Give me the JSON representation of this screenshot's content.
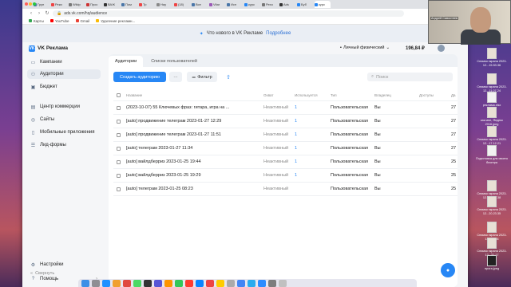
{
  "browser": {
    "tabs": [
      "Груп",
      "Реки",
      "Wikip",
      "Прос",
      "ВАЖ",
      "Пом",
      "Тр",
      "Нау",
      "(18)",
      "Все",
      "Vitar",
      "Исп",
      "курс",
      "Рехо",
      "Ads",
      "Буб",
      "курс"
    ],
    "url": "ads.vk.com/hq/audience",
    "bookmarks": [
      "Карты",
      "YouTube",
      "Gmail",
      "Удаление рекламн..."
    ]
  },
  "announce": {
    "text": "Что нового в VK Рекламе",
    "link": "Подробнее"
  },
  "header": {
    "logo": "VK Реклама",
    "account": "Личный физический",
    "balance": "196,84 ₽"
  },
  "sidebar": {
    "items": [
      {
        "label": "Кампании",
        "icon": "campaigns-icon",
        "glyph": "▭"
      },
      {
        "label": "Аудитории",
        "icon": "audiences-icon",
        "glyph": "👥"
      },
      {
        "label": "Бюджет",
        "icon": "budget-icon",
        "glyph": "▣"
      },
      {
        "label": "Центр коммерции",
        "icon": "commerce-icon",
        "glyph": "▤"
      },
      {
        "label": "Сайты",
        "icon": "sites-icon",
        "glyph": "◎"
      },
      {
        "label": "Мобильные приложения",
        "icon": "mobile-icon",
        "glyph": "▯"
      },
      {
        "label": "Лид-формы",
        "icon": "leadforms-icon",
        "glyph": "☰"
      }
    ],
    "bottom": [
      {
        "label": "Настройки",
        "icon": "settings-icon",
        "glyph": "⚙"
      },
      {
        "label": "Помощь",
        "icon": "help-icon",
        "glyph": "?"
      }
    ],
    "collapse": "Свернуть"
  },
  "panel": {
    "tabs": [
      "Аудитории",
      "Списки пользователей"
    ],
    "create": "Создать аудиторию",
    "filter": "Фильтр",
    "search_placeholder": "Поиск"
  },
  "table": {
    "headers": {
      "name": "Название",
      "coverage": "Охват",
      "used": "Используется",
      "type": "Тип",
      "owner": "Владелец",
      "access": "Доступы",
      "date": "Да"
    },
    "rows": [
      {
        "name": "(2023-10-07) 55 Ключевых фраз: гитара, игра на ...",
        "coverage": "Неактивный",
        "used": "1",
        "type": "Пользовательская",
        "owner": "Вы",
        "date": "27"
      },
      {
        "name": "[auto] продвижение телеграм 2023-01-27 12:29",
        "coverage": "Неактивный",
        "used": "1",
        "type": "Пользовательская",
        "owner": "Вы",
        "date": "27"
      },
      {
        "name": "[auto] продвижение телеграм 2023-01-27 11:51",
        "coverage": "Неактивный",
        "used": "1",
        "type": "Пользовательская",
        "owner": "Вы",
        "date": "27"
      },
      {
        "name": "[auto] телеграм 2023-01-27 11:34",
        "coverage": "Неактивный",
        "used": "1",
        "type": "Пользовательская",
        "owner": "Вы",
        "date": "27"
      },
      {
        "name": "[auto] вайлдберриз 2023-01-25 19:44",
        "coverage": "Неактивный",
        "used": "1",
        "type": "Пользовательская",
        "owner": "Вы",
        "date": "25"
      },
      {
        "name": "[auto] вайлдберриз 2023-01-25 19:29",
        "coverage": "Неактивный",
        "used": "1",
        "type": "Пользовательская",
        "owner": "Вы",
        "date": "25"
      },
      {
        "name": "[auto] телеграм 2023-01-25 08:23",
        "coverage": "Неактивный",
        "used": "",
        "type": "Пользовательская",
        "owner": "Вы",
        "date": "25"
      }
    ]
  },
  "video": {
    "name": "Андрей Савостеев"
  },
  "desktop_files": [
    {
      "name": "Снимок экрана 2023-12...15.53.36"
    },
    {
      "name": "Снимок экрана 2023-12...11.07.24"
    },
    {
      "name": "реклама.xlsx"
    },
    {
      "name": "как мне, Яндекс 2016.jpeg"
    },
    {
      "name": "Снимок экрана 2023-12...17.12.21"
    },
    {
      "name": "Подготовка для своего блогера"
    },
    {
      "name": "Снимок экрана 2023-12...20.23.38"
    },
    {
      "name": "Снимок экрана 2023-12...20.23.35"
    },
    {
      "name": "Снимок экрана 2023-12...44.58"
    },
    {
      "name": "Снимок экрана 2023-12...21.17"
    },
    {
      "name": "прога.jpeg"
    }
  ]
}
